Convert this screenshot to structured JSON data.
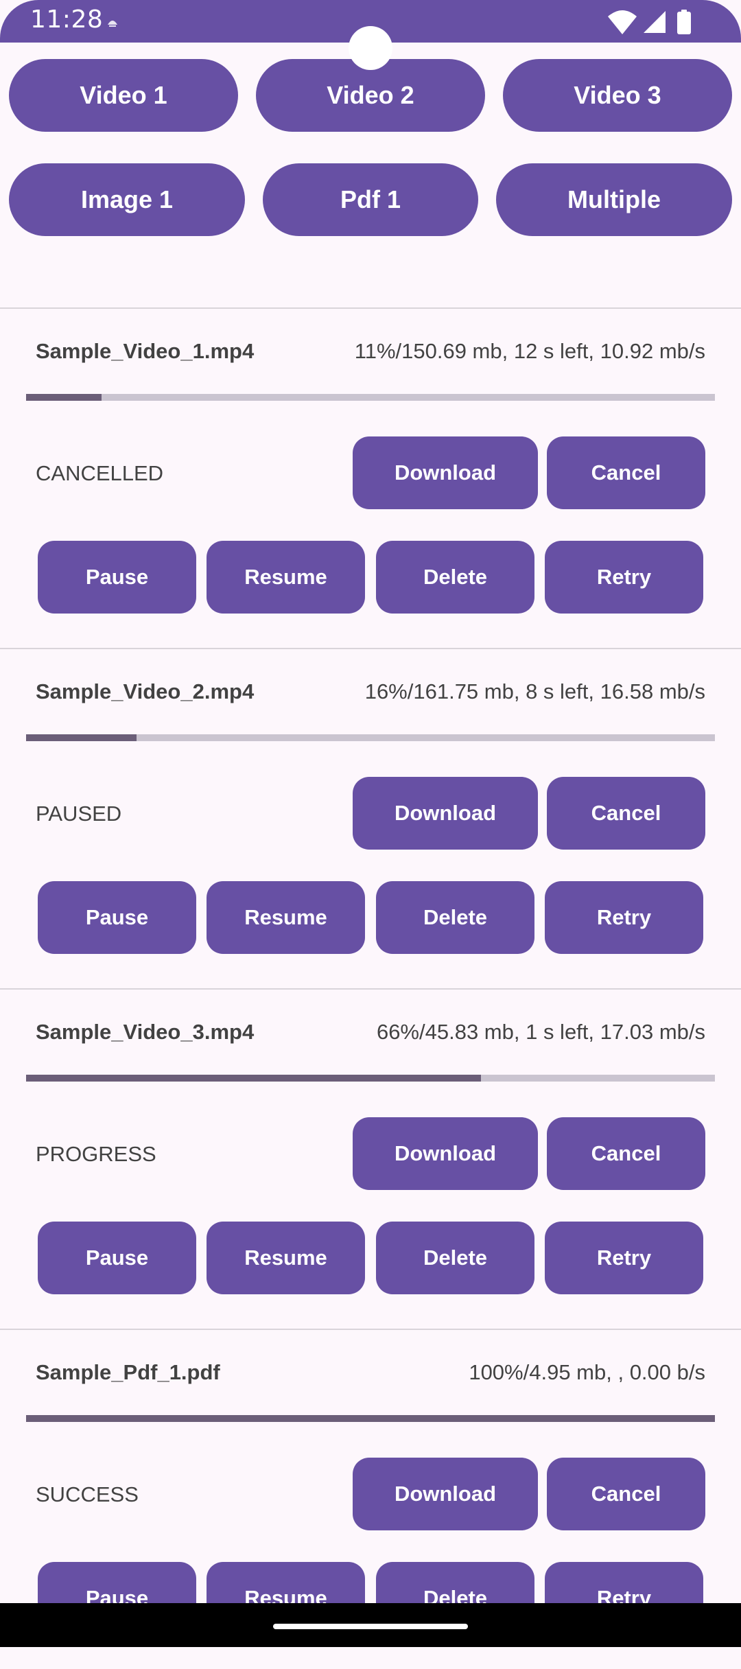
{
  "status_bar": {
    "time": "11:28",
    "bg_color": "#6750A4"
  },
  "top_buttons": {
    "row1": [
      "Video 1",
      "Video 2",
      "Video 3"
    ],
    "row2": [
      "Image 1",
      "Pdf 1",
      "Multiple"
    ]
  },
  "downloads": [
    {
      "file_name": "Sample_Video_1.mp4",
      "progress_text": "11%/150.69 mb, 12 s left, 10.92 mb/s",
      "progress_fraction": 0.11,
      "status": "CANCELLED",
      "actions": {
        "download": "Download",
        "cancel": "Cancel",
        "pause": "Pause",
        "resume": "Resume",
        "delete": "Delete",
        "retry": "Retry"
      }
    },
    {
      "file_name": "Sample_Video_2.mp4",
      "progress_text": "16%/161.75 mb, 8 s left, 16.58 mb/s",
      "progress_fraction": 0.16,
      "status": "PAUSED",
      "actions": {
        "download": "Download",
        "cancel": "Cancel",
        "pause": "Pause",
        "resume": "Resume",
        "delete": "Delete",
        "retry": "Retry"
      }
    },
    {
      "file_name": "Sample_Video_3.mp4",
      "progress_text": "66%/45.83 mb, 1 s left, 17.03 mb/s",
      "progress_fraction": 0.66,
      "status": "PROGRESS",
      "actions": {
        "download": "Download",
        "cancel": "Cancel",
        "pause": "Pause",
        "resume": "Resume",
        "delete": "Delete",
        "retry": "Retry"
      }
    },
    {
      "file_name": "Sample_Pdf_1.pdf",
      "progress_text": "100%/4.95 mb, , 0.00 b/s",
      "progress_fraction": 1.0,
      "status": "SUCCESS",
      "actions": {
        "download": "Download",
        "cancel": "Cancel",
        "pause": "Pause",
        "resume": "Resume",
        "delete": "Delete",
        "retry": "Retry"
      }
    }
  ],
  "colors": {
    "primary": "#6750A4",
    "background": "#FDF7FC",
    "progress_fill": "#6B5E78",
    "progress_track": "#CAC4D0"
  },
  "icons": {
    "notification": "notification-icon",
    "wifi": "wifi-icon",
    "signal": "cell-signal-icon",
    "battery": "battery-icon"
  }
}
